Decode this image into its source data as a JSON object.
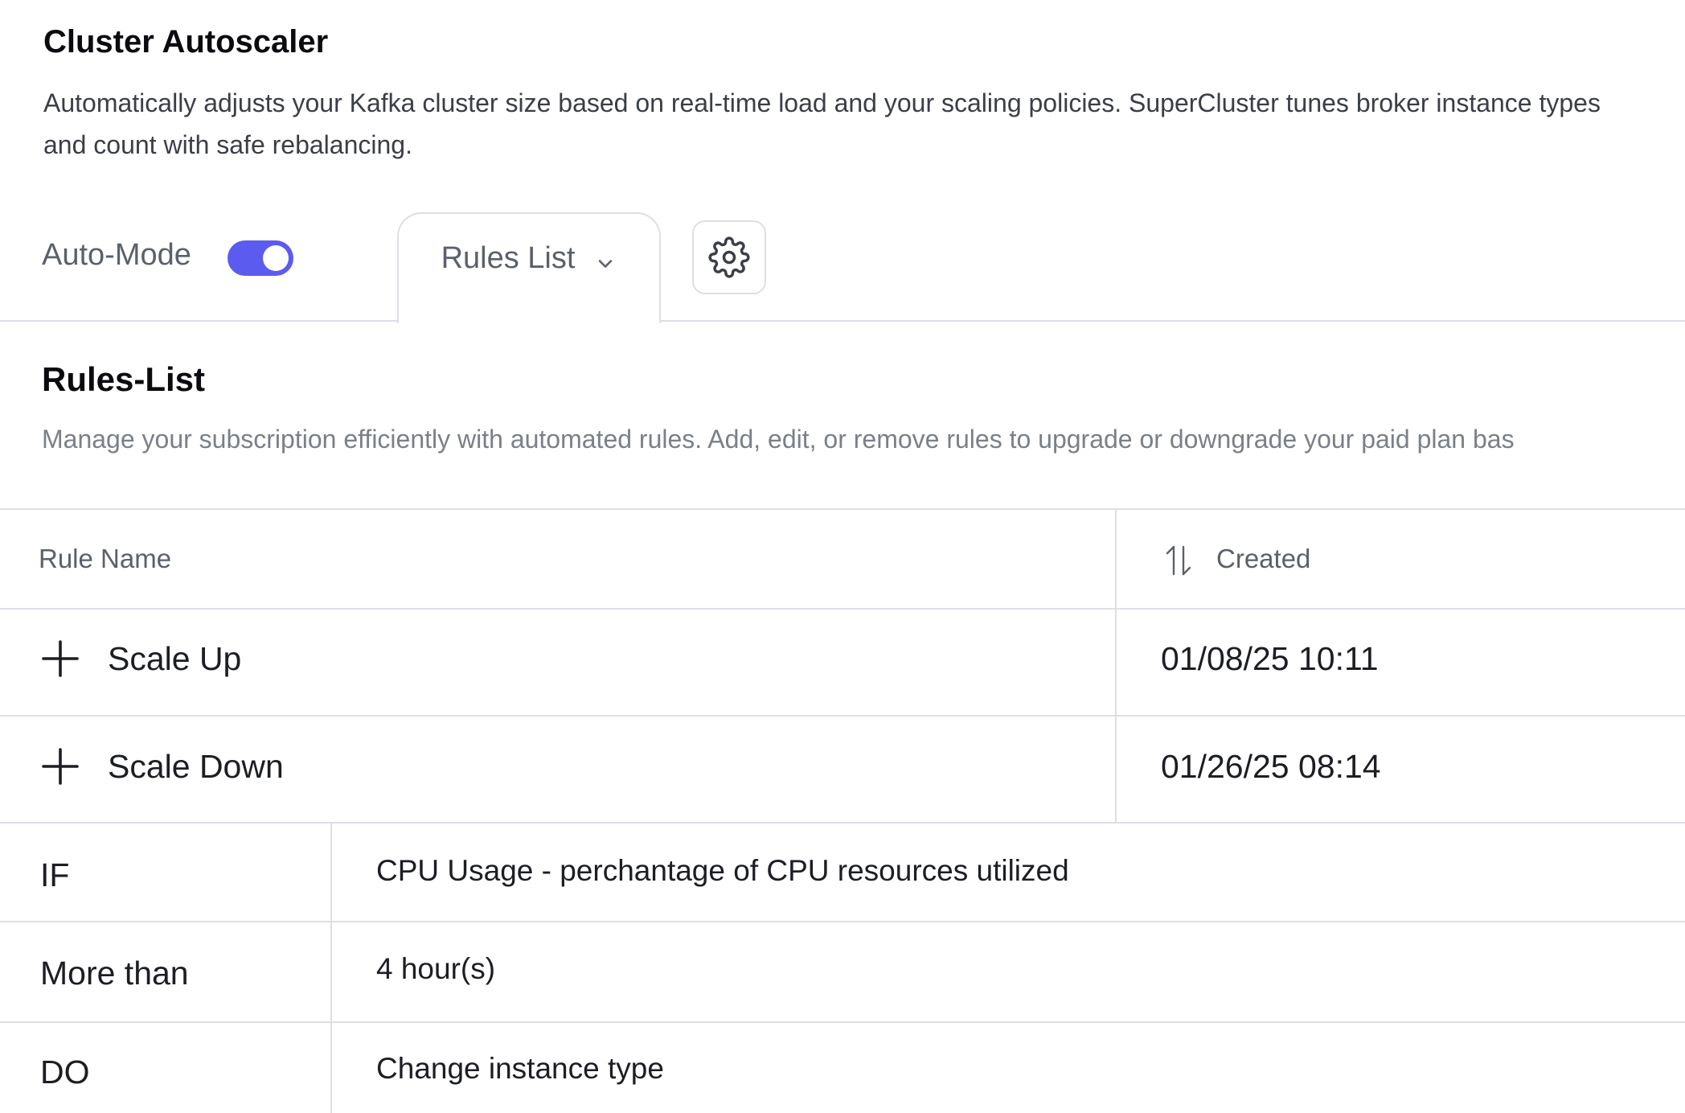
{
  "header": {
    "title": "Cluster Autoscaler",
    "description": "Automatically adjusts your Kafka cluster size based on real-time load and your scaling policies. SuperCluster tunes broker instance types and count with safe rebalancing."
  },
  "toolbar": {
    "auto_mode_label": "Auto-Mode",
    "auto_mode_enabled": true,
    "rules_tab_label": "Rules List",
    "settings_icon": "gear-icon",
    "chevron_icon": "chevron-down-icon"
  },
  "section": {
    "title": "Rules-List",
    "description": "Manage your subscription efficiently with automated rules. Add, edit, or remove rules to upgrade or downgrade your paid plan bas"
  },
  "table": {
    "columns": {
      "rule_name": "Rule Name",
      "created": "Created"
    },
    "rows": [
      {
        "name": "Scale Up",
        "created": "01/08/25 10:11"
      },
      {
        "name": "Scale Down",
        "created": "01/26/25 08:14"
      }
    ]
  },
  "rule_detail": {
    "rows": [
      {
        "label": "IF",
        "value": "CPU Usage - perchantage of CPU resources utilized"
      },
      {
        "label": "More than",
        "value": "4 hour(s)"
      },
      {
        "label": "DO",
        "value": "Change instance type"
      }
    ]
  },
  "colors": {
    "accent": "#5B5BF0",
    "border": "#DCDFE5",
    "text_primary": "#1C1E24",
    "text_secondary": "#5B606B"
  }
}
